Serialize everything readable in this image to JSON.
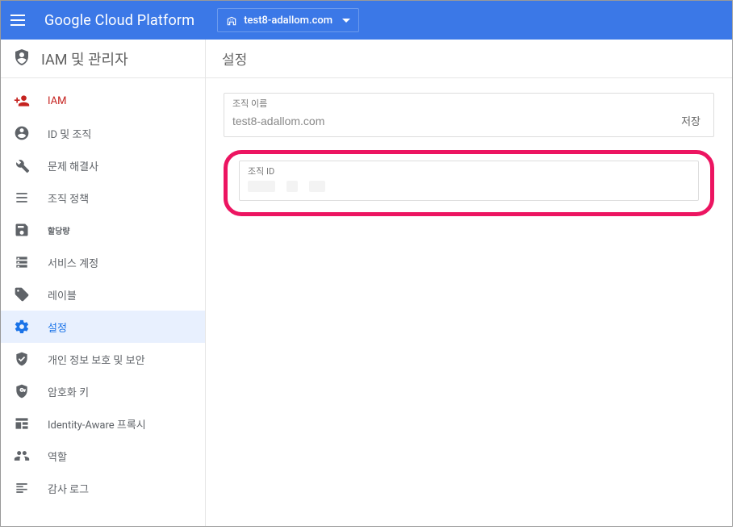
{
  "topbar": {
    "brand": "Google Cloud Platform",
    "project_name": "test8-adallom.com"
  },
  "subheader": {
    "section_title": "IAM 및 관리자",
    "page_title": "설정"
  },
  "sidebar": {
    "items": [
      {
        "id": "iam",
        "label": "IAM",
        "active": false
      },
      {
        "id": "identity-org",
        "label": "ID 및 조직",
        "active": false
      },
      {
        "id": "troubleshooter",
        "label": "문제 해결사",
        "active": false
      },
      {
        "id": "org-policies",
        "label": "조직 정책",
        "active": false
      },
      {
        "id": "quotas",
        "label": "할당량",
        "active": false
      },
      {
        "id": "service-accounts",
        "label": "서비스 계정",
        "active": false
      },
      {
        "id": "labels",
        "label": "레이블",
        "active": false
      },
      {
        "id": "settings",
        "label": "설정",
        "active": true
      },
      {
        "id": "privacy-security",
        "label": "개인 정보 보호 및 보안",
        "active": false
      },
      {
        "id": "crypto-keys",
        "label": "암호화 키",
        "active": false
      },
      {
        "id": "iap",
        "label": "Identity-Aware 프록시",
        "active": false
      },
      {
        "id": "roles",
        "label": "역할",
        "active": false
      },
      {
        "id": "audit-logs",
        "label": "감사 로그",
        "active": false
      }
    ]
  },
  "main": {
    "org_name_label": "조직 이름",
    "org_name_value": "test8-adallom.com",
    "save_label": "저장",
    "org_id_label": "조직 ID",
    "org_id_value": ""
  }
}
